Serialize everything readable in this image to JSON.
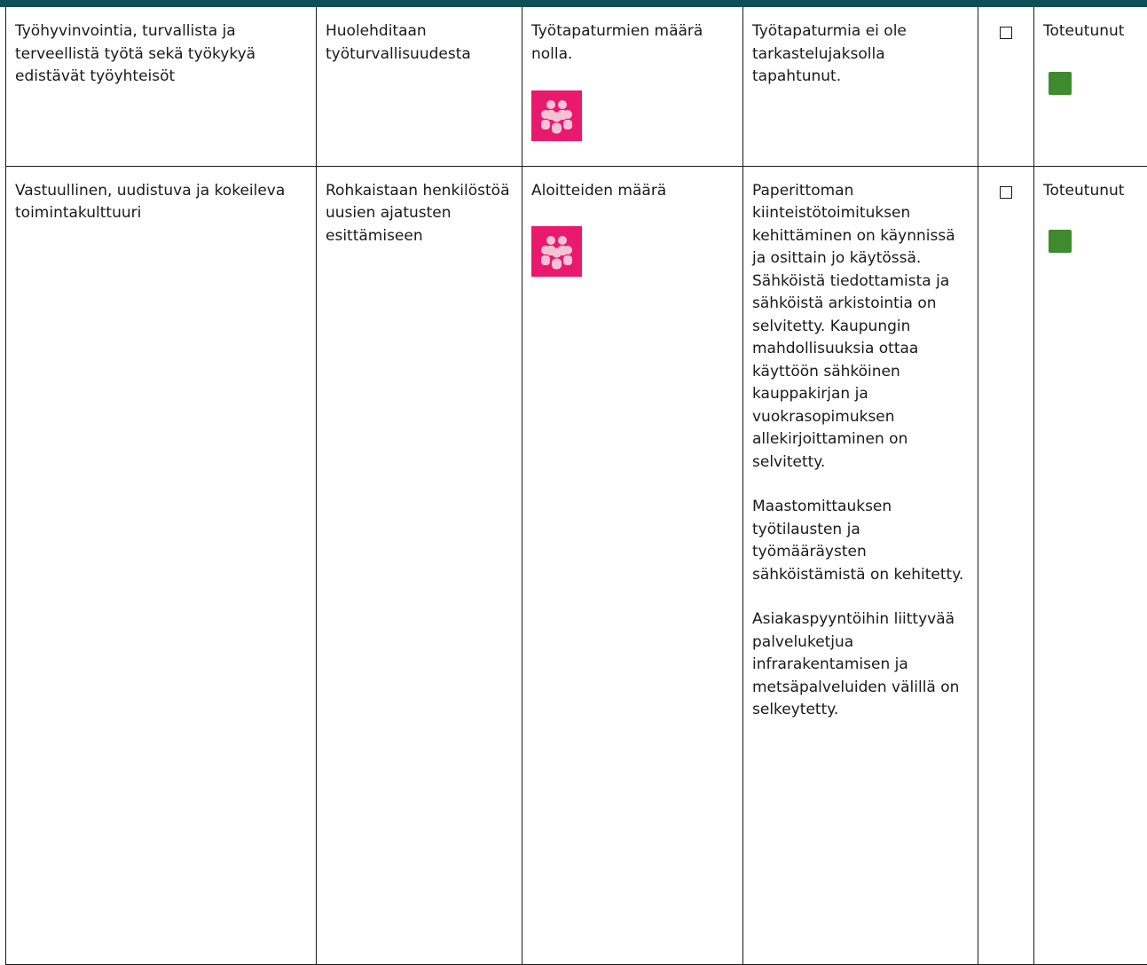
{
  "colors": {
    "header_bar": "#0d4f56",
    "indicator_icon_bg": "#e9196e",
    "status_achieved": "#3f8a2e",
    "border": "#1a1a1a"
  },
  "rows": [
    {
      "goal": "Työhyvinvointia, turvallista ja terveellistä työtä sekä työkykyä edistävät työyhteisöt",
      "action": "Huolehditaan työturvallisuudesta",
      "target": "Työtapaturmien määrä nolla.",
      "target_icon": "people-group-icon",
      "outcome": [
        "Työtapaturmia ei ole tarkastelujaksolla tapahtunut."
      ],
      "checked": false,
      "status": "Toteutunut",
      "status_color": "#3f8a2e"
    },
    {
      "goal": "Vastuullinen, uudistuva ja kokeileva toimintakulttuuri",
      "action": "Rohkaistaan henkilöstöä uusien ajatusten esittämiseen",
      "target": "Aloitteiden määrä",
      "target_icon": "people-group-icon",
      "outcome": [
        "Paperittoman kiinteistötoimituksen kehittäminen on käynnissä ja osittain jo käytössä. Sähköistä tiedottamista ja sähköistä arkistointia on selvitetty. Kaupungin mahdollisuuksia ottaa käyttöön sähköinen kauppakirjan ja vuokrasopimuksen allekirjoittaminen on selvitetty.",
        "Maastomittauksen työtilausten ja työmääräysten sähköistämistä on kehitetty.",
        "Asiakaspyyntöihin liittyvää palveluketjua infrarakentamisen ja metsäpalveluiden välillä on selkeytetty."
      ],
      "checked": false,
      "status": "Toteutunut",
      "status_color": "#3f8a2e"
    }
  ]
}
